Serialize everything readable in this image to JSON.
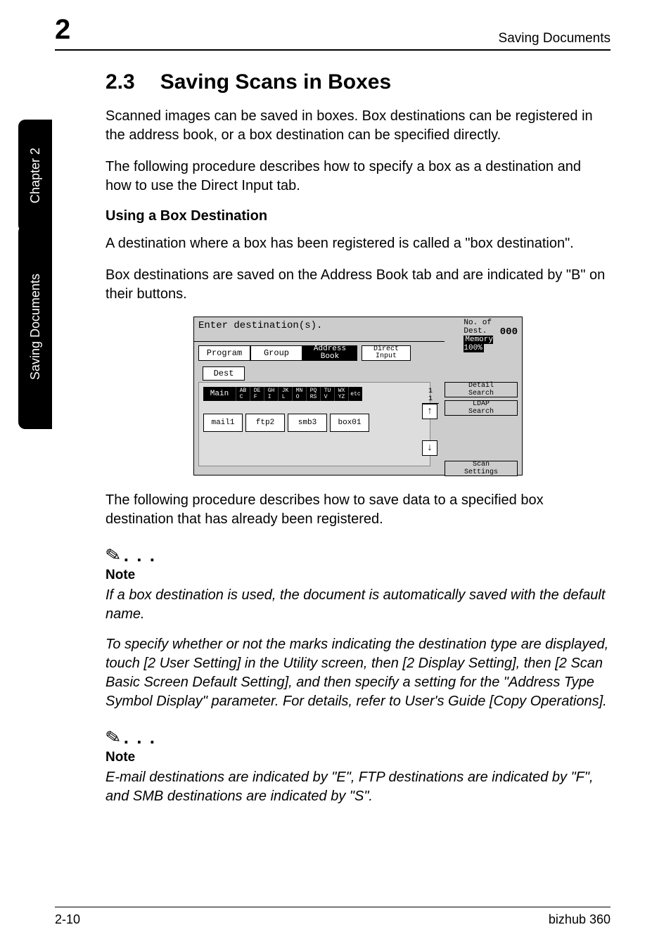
{
  "header": {
    "chapter_number": "2",
    "running_title": "Saving Documents"
  },
  "sidebar": {
    "chapter_label": "Chapter 2",
    "section_label": "Saving Documents"
  },
  "section": {
    "number": "2.3",
    "title": "Saving Scans in Boxes",
    "para1": "Scanned images can be saved in boxes. Box destinations can be registered in the address book, or a box destination can be specified directly.",
    "para2": "The following procedure describes how to specify a box as a destination and how to use the Direct Input tab."
  },
  "subsection": {
    "title": "Using a Box Destination",
    "para1": "A destination where a box has been registered is called a \"box destination\".",
    "para2": "Box destinations are saved on the Address Book tab and are indicated by \"B\" on their buttons."
  },
  "screenshot": {
    "prompt": "Enter destination(s).",
    "count_label": "No. of\nDest.",
    "count_value": "000",
    "memory": "Memory 100%",
    "tabs": {
      "program": "Program",
      "group": "Group",
      "address": "Address\nBook",
      "direct": "Direct\nInput"
    },
    "dest_tab": "Dest",
    "main_label": "Main",
    "segments": [
      "AB\nC",
      "DE\nF",
      "GH\nI",
      "JK\nL",
      "MN\nO",
      "PQ\nRS",
      "TU\nV",
      "WX\nYZ",
      "etc"
    ],
    "buttons": [
      "mail1",
      "ftp2",
      "smb3",
      "box01"
    ],
    "frac": "1\n1",
    "right": {
      "detail": "Detail\nSearch",
      "ldap": "LDAP\nSearch",
      "scan": "Scan\nSettings"
    },
    "scroll_up": "↑",
    "scroll_down": "↓"
  },
  "after_shot": "The following procedure describes how to save data to a specified box destination that has already been registered.",
  "note1": {
    "heading": "Note",
    "body1": "If a box destination is used, the document is automatically saved with the default name.",
    "body2": "To specify whether or not the marks indicating the destination type are displayed, touch [2 User Setting] in the Utility screen, then [2 Display Setting], then [2 Scan Basic Screen Default Setting], and then specify a setting for the \"Address Type Symbol Display\" parameter. For details, refer to User's Guide [Copy Operations]."
  },
  "note2": {
    "heading": "Note",
    "body": "E-mail destinations are indicated by \"E\", FTP destinations are indicated by \"F\", and SMB destinations are indicated by \"S\"."
  },
  "footer": {
    "left": "2-10",
    "right": "bizhub 360"
  },
  "dots": ". . ."
}
